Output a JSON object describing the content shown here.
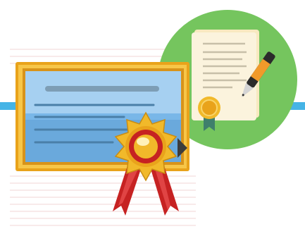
{
  "scene": {
    "colors": {
      "background": "#ffffff",
      "stripe_lines": "#f0d6d6",
      "accent_bar": "#45b4e6",
      "circle_green": "#75c55e",
      "certificate_frame_gold": "#e9a31b",
      "certificate_panel_blue": "#79b7e8",
      "seal_gold": "#f1b92a",
      "seal_red": "#c62222",
      "paper_cream": "#fbf3dd",
      "ribbon_teal": "#3f7f6c",
      "pen_orange": "#f19a2a"
    },
    "icons": [
      "certificate-icon",
      "award-seal-icon",
      "signed-document-icon",
      "fountain-pen-icon"
    ]
  }
}
